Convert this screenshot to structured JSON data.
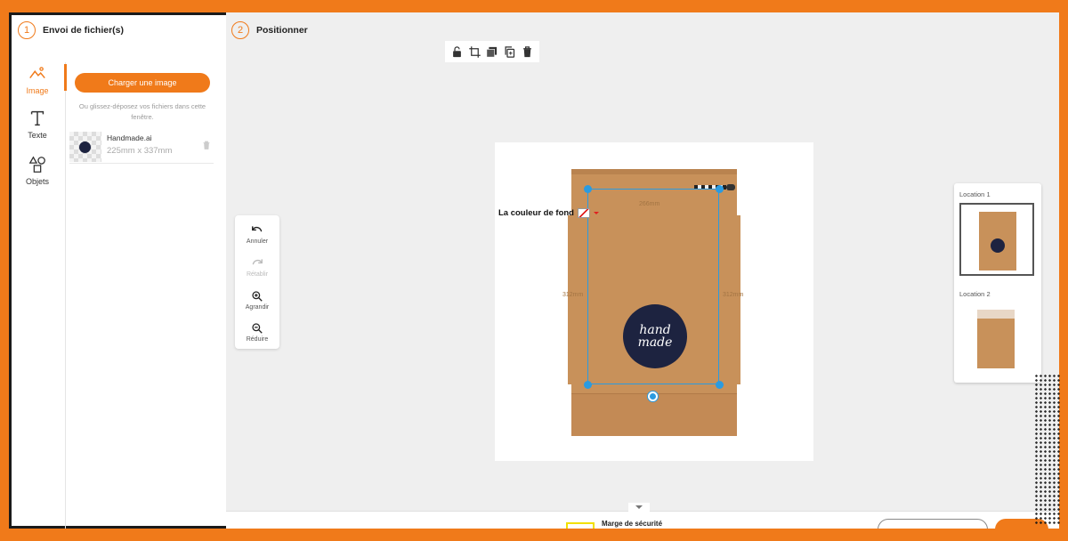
{
  "steps": [
    {
      "number": "1",
      "title": "Envoi de fichier(s)"
    },
    {
      "number": "2",
      "title": "Positionner"
    }
  ],
  "sidebar": {
    "items": [
      {
        "label": "Image",
        "icon": "image-icon",
        "active": true
      },
      {
        "label": "Texte",
        "icon": "text-icon",
        "active": false
      },
      {
        "label": "Objets",
        "icon": "shapes-icon",
        "active": false
      }
    ]
  },
  "upload": {
    "button_label": "Charger une image",
    "hint": "Ou glissez-déposez vos fichiers dans cette fenêtre.",
    "file": {
      "name": "Handmade.ai",
      "size": "225mm x 337mm"
    }
  },
  "toolbar": {
    "icons": [
      "lock-icon",
      "crop-icon",
      "layers-icon",
      "duplicate-icon",
      "trash-icon"
    ]
  },
  "history_tools": [
    {
      "label": "Annuler",
      "icon": "undo-icon",
      "enabled": true
    },
    {
      "label": "Rétablir",
      "icon": "redo-icon",
      "enabled": false
    },
    {
      "label": "Agrandir",
      "icon": "zoom-in-icon",
      "enabled": true
    },
    {
      "label": "Réduire",
      "icon": "zoom-out-icon",
      "enabled": true
    }
  ],
  "canvas": {
    "background_color_label": "La couleur de fond",
    "logo_lines": [
      "hand",
      "made"
    ],
    "dimensions": {
      "top": "266mm",
      "left": "312mm",
      "right": "312mm"
    }
  },
  "locations": [
    {
      "label": "Location 1",
      "selected": true
    },
    {
      "label": "Location 2",
      "selected": false
    }
  ],
  "footer": {
    "safety_margin_label": "Marge de sécurité"
  },
  "colors": {
    "accent": "#f07a1a",
    "selection": "#2b9be0",
    "kraft": "#c8915a",
    "logo": "#1d2340"
  }
}
